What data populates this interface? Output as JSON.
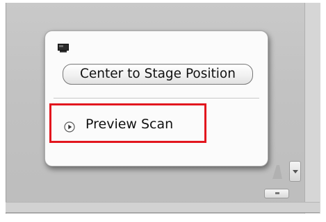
{
  "popup": {
    "window_icon": "screen-icon",
    "center_button_label": "Center to Stage Position",
    "preview_item": {
      "icon": "play-circle-icon",
      "label": "Preview Scan",
      "highlighted": true,
      "highlight_color": "#e2161e"
    }
  },
  "colors": {
    "background": "#c4c4c4",
    "popup_background": "#fbfbfb",
    "highlight": "#e2161e"
  },
  "scroll": {
    "icon": "chevron-down-icon"
  }
}
